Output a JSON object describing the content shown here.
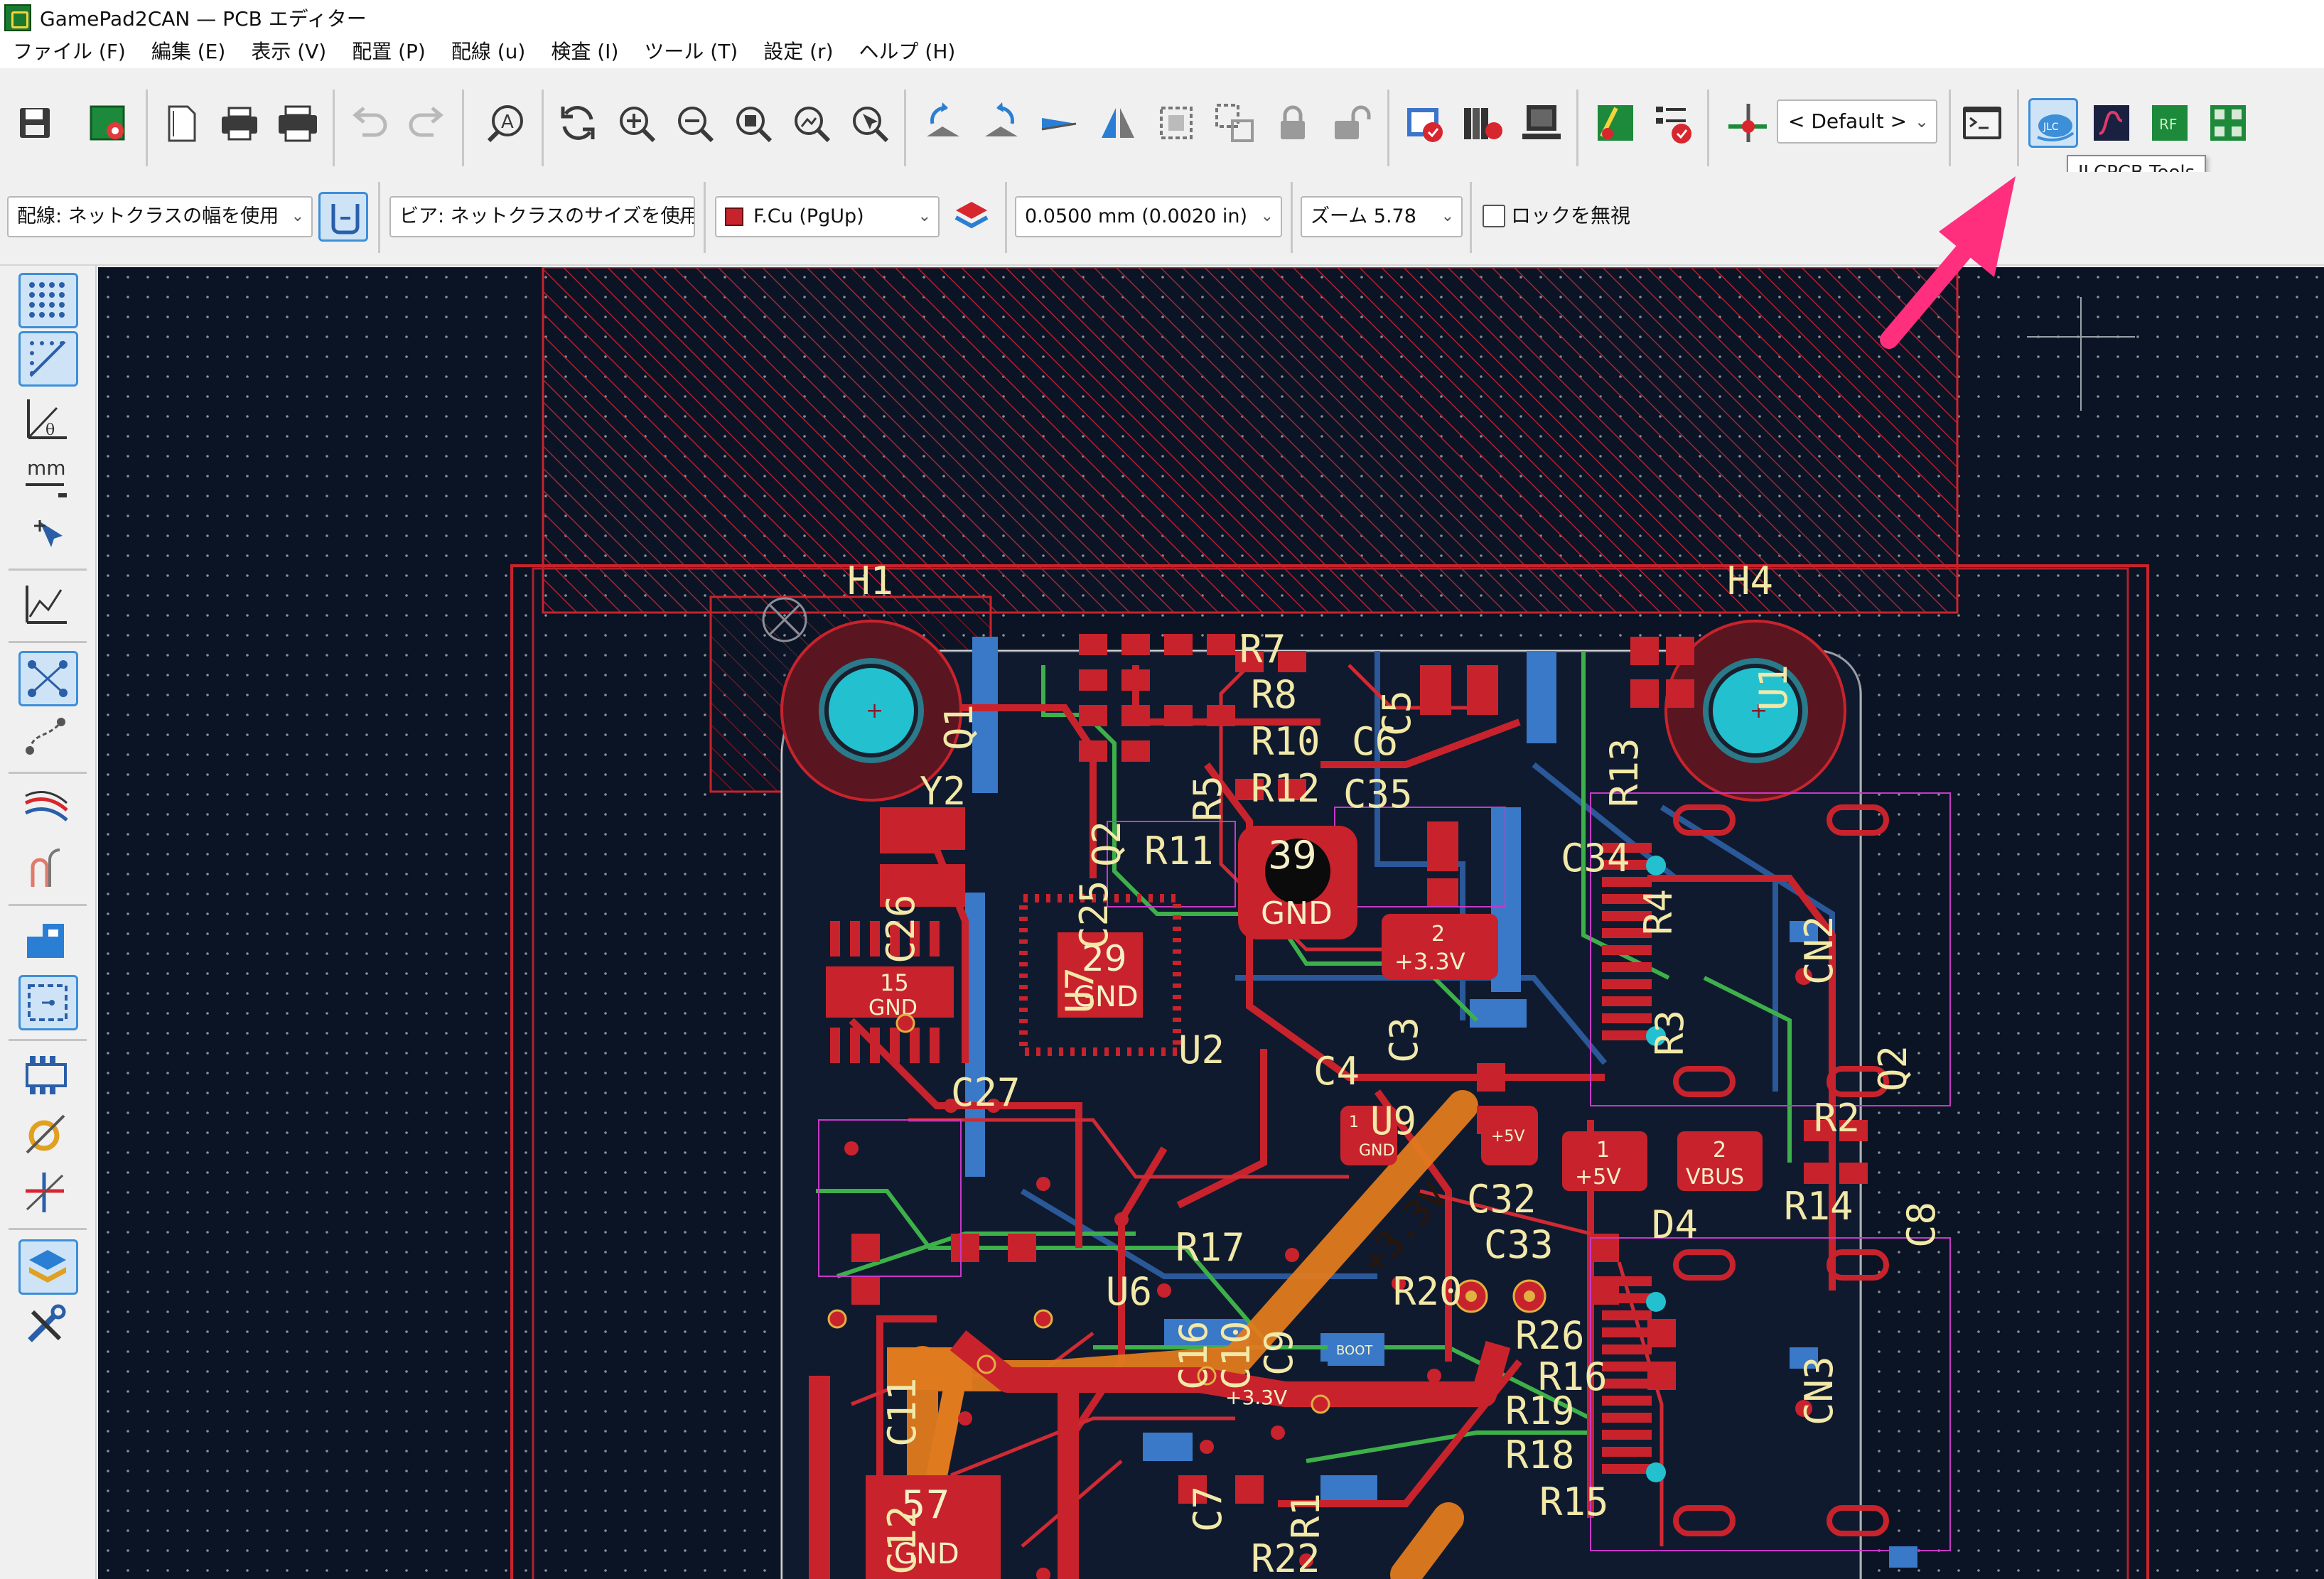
{
  "window": {
    "title": "GamePad2CAN — PCB エディター",
    "icon": "kicad-pcb-icon"
  },
  "menu": [
    "ファイル (F)",
    "編集 (E)",
    "表示 (V)",
    "配置 (P)",
    "配線 (u)",
    "検査 (I)",
    "ツール (T)",
    "設定 (r)",
    "ヘルプ (H)"
  ],
  "toolbar": {
    "buttons": [
      "save-icon",
      "board-setup-icon",
      "page-settings-icon",
      "print-icon",
      "plot-icon",
      "undo-icon",
      "redo-icon",
      "find-icon",
      "refresh-icon",
      "zoom-in-icon",
      "zoom-out-icon",
      "zoom-fit-icon",
      "zoom-objects-icon",
      "zoom-selection-icon",
      "rotate-ccw-icon",
      "rotate-cw-icon",
      "flip-icon",
      "mirror-icon",
      "group-icon",
      "ungroup-icon",
      "lock-icon",
      "unlock-icon",
      "drc-icon",
      "footprint-library-icon",
      "footprint-editor-icon",
      "netlist-update-icon",
      "drc-check-icon",
      "interactive-router-icon",
      "scripting-console-icon",
      "jlcpcb-tools-icon",
      "signal-integrity-icon",
      "rf-tools-icon",
      "footprint-wizard-icon"
    ],
    "preset_selector": "< Default >",
    "tooltip": "JLCPCB Tools"
  },
  "aux_toolbar": {
    "track_width": "配線: ネットクラスの幅を使用",
    "via_size": "ビア: ネットクラスのサイズを使用",
    "layer": "F.Cu (PgUp)",
    "layer_color": "#c8232c",
    "grid": "0.0500 mm (0.0020 in)",
    "zoom": "ズーム 5.78",
    "override_locks_label": "ロックを無視",
    "override_locks_checked": false
  },
  "left_toolbar": [
    "grid-dots-icon",
    "grid-overrides-icon",
    "polar-coords-icon",
    "units-mm-icon",
    "cursor-style-icon",
    "ratsnest-curves-icon",
    "show-ratsnest-icon",
    "curved-ratsnest-icon",
    "high-contrast-icon",
    "track-clearance-icon",
    "zones-fill-icon",
    "zones-outline-icon",
    "footprint-pads-icon",
    "via-display-icon",
    "track-display-icon",
    "layers-manager-icon",
    "properties-icon"
  ],
  "pcb": {
    "refs": [
      "H1",
      "H4",
      "R7",
      "R8",
      "C5",
      "R10",
      "C6",
      "R12",
      "C35",
      "R13",
      "U1",
      "Q1",
      "Y2",
      "R5",
      "Q2",
      "R11",
      "C34",
      "C26",
      "C25",
      "U7",
      "R4",
      "CN2",
      "U2",
      "C4",
      "C3",
      "R3",
      "Q2",
      "C27",
      "U9",
      "R2",
      "C32",
      "D4",
      "R14",
      "C8",
      "R17",
      "C33",
      "U6",
      "R20",
      "R26",
      "R16",
      "CN3",
      "C16",
      "C10",
      "C11",
      "C12",
      "R19",
      "R18",
      "C7",
      "R1",
      "R15",
      "R22",
      "C9"
    ],
    "pads": {
      "u2_center": "29",
      "u2_net": "GND",
      "big_pad": "39",
      "big_net": "GND",
      "u7_pad": "15",
      "u7_net": "GND",
      "u6_pad": "57",
      "u6_net": "GND",
      "c34_pad": "2",
      "c34_net": "+3.3V",
      "u9_net": "+3.3V",
      "net_5v": "+5V",
      "net_vbus": "VBUS",
      "pad1": "1",
      "pad2": "2",
      "trace_net": "+3.3V",
      "pad_boot": "BOOT",
      "pad_gnd": "GND"
    }
  }
}
